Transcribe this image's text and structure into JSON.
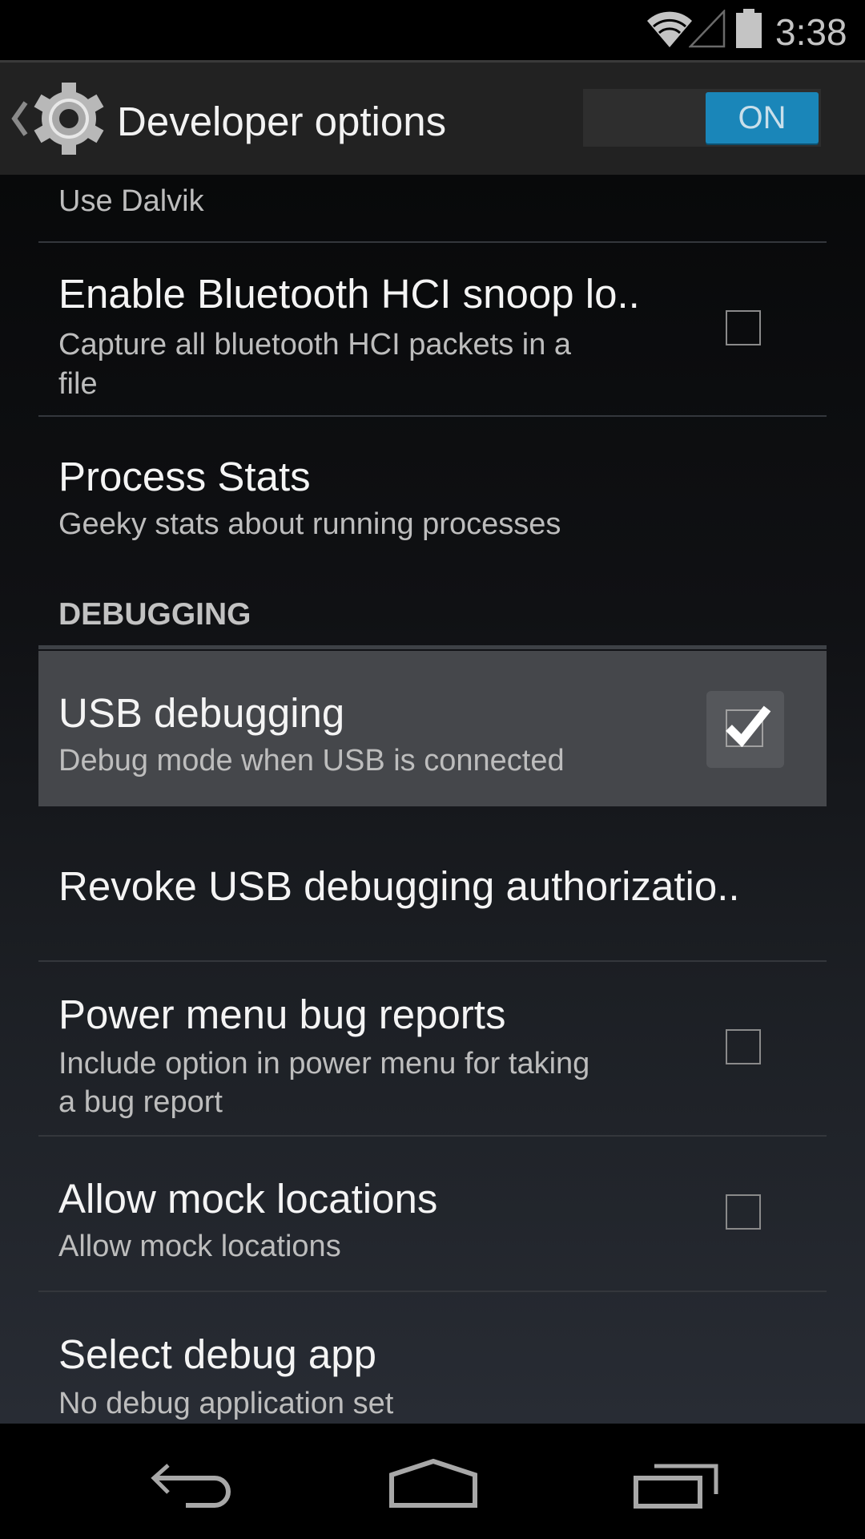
{
  "status_bar": {
    "time": "3:38",
    "icons": [
      "wifi-icon",
      "cell-signal-icon",
      "battery-icon"
    ]
  },
  "action_bar": {
    "title": "Developer options",
    "up_icon": "chevron-left-icon",
    "app_icon": "gear-icon",
    "master_switch": {
      "label": "ON",
      "state": true,
      "accent_color": "#1a86b9"
    }
  },
  "preferences": {
    "use_dalvik": {
      "summary": "Use Dalvik"
    },
    "bt_hci_snoop": {
      "title": "Enable Bluetooth HCI snoop lo..",
      "summary_line1": "Capture all bluetooth HCI packets in a",
      "summary_line2": "file",
      "checked": false
    },
    "process_stats": {
      "title": "Process Stats",
      "summary": "Geeky stats about running processes"
    },
    "debugging_header": "DEBUGGING",
    "usb_debugging": {
      "title": "USB debugging",
      "summary": "Debug mode when USB is connected",
      "checked": true
    },
    "revoke_usb": {
      "title": "Revoke USB debugging authorizatio.."
    },
    "power_menu_bug_reports": {
      "title": "Power menu bug reports",
      "summary_line1": "Include option in power menu for taking",
      "summary_line2": "a bug report",
      "checked": false
    },
    "mock_locations": {
      "title": "Allow mock locations",
      "summary": "Allow mock locations",
      "checked": false
    },
    "select_debug_app": {
      "title": "Select debug app",
      "summary": "No debug application set"
    }
  },
  "nav_bar": {
    "buttons": [
      "back-icon",
      "home-icon",
      "recents-icon"
    ]
  }
}
